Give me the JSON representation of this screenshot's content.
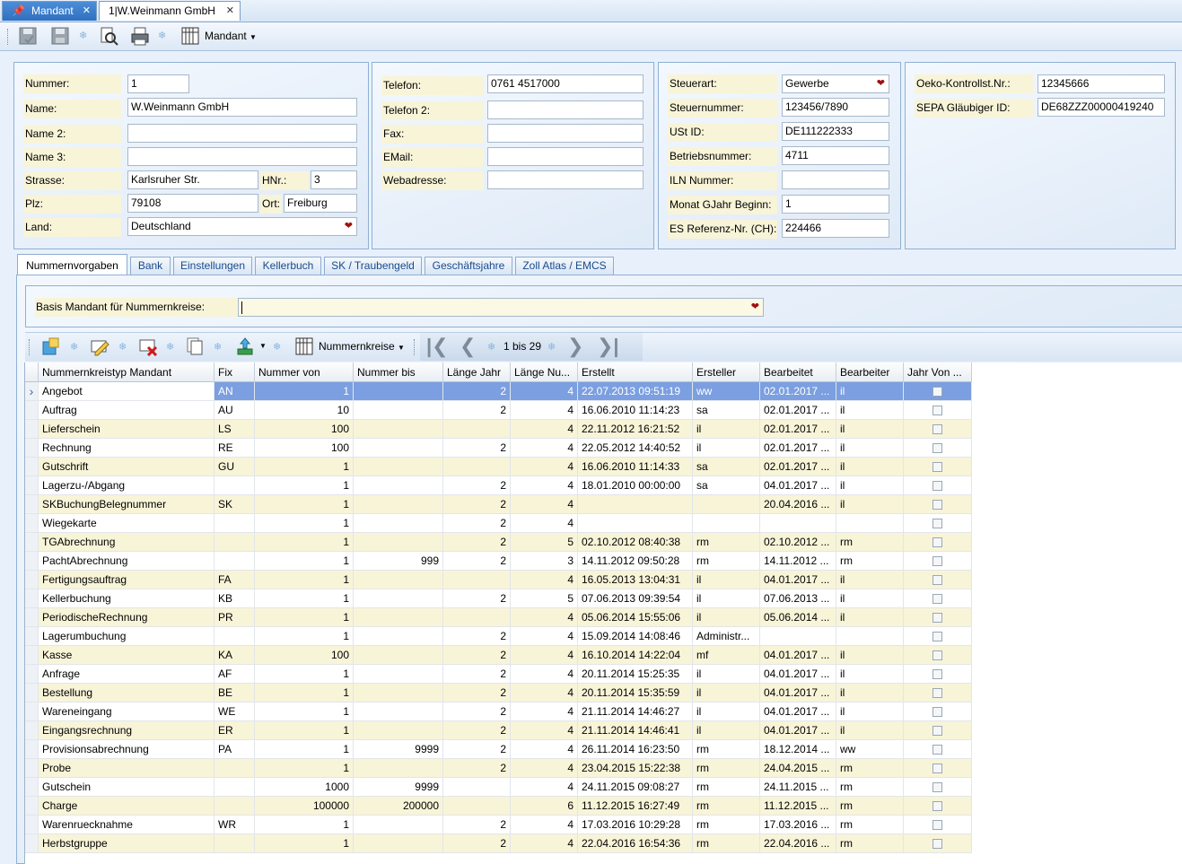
{
  "tabs": [
    {
      "label": "Mandant"
    },
    {
      "label": "1|W.Weinmann GmbH"
    }
  ],
  "toolbar": {
    "mandant_label": "Mandant"
  },
  "form": {
    "nummer_label": "Nummer:",
    "nummer": "1",
    "name_label": "Name:",
    "name": "W.Weinmann GmbH",
    "name2_label": "Name 2:",
    "name2": "",
    "name3_label": "Name 3:",
    "name3": "",
    "strasse_label": "Strasse:",
    "strasse": "Karlsruher Str.",
    "hnr_label": "HNr.:",
    "hnr": "3",
    "plz_label": "Plz:",
    "plz": "79108",
    "ort_label": "Ort:",
    "ort": "Freiburg",
    "land_label": "Land:",
    "land": "Deutschland",
    "telefon_label": "Telefon:",
    "telefon": "0761 4517000",
    "telefon2_label": "Telefon 2:",
    "telefon2": "",
    "fax_label": "Fax:",
    "fax": "",
    "email_label": "EMail:",
    "email": "",
    "web_label": "Webadresse:",
    "web": "",
    "steuerart_label": "Steuerart:",
    "steuerart": "Gewerbe",
    "steuernummer_label": "Steuernummer:",
    "steuernummer": "123456/7890",
    "ustid_label": "USt ID:",
    "ustid": "DE111222333",
    "betrieb_label": "Betriebsnummer:",
    "betrieb": "4711",
    "iln_label": "ILN Nummer:",
    "iln": "",
    "monat_label": "Monat GJahr Beginn:",
    "monat": "1",
    "esref_label": "ES Referenz-Nr. (CH):",
    "esref": "224466",
    "oeko_label": "Oeko-Kontrollst.Nr.:",
    "oeko": "12345666",
    "sepa_label": "SEPA Gläubiger ID:",
    "sepa": "DE68ZZZ00000419240"
  },
  "detail_tabs": [
    "Nummernvorgaben",
    "Bank",
    "Einstellungen",
    "Kellerbuch",
    "SK / Traubengeld",
    "Geschäftsjahre",
    "Zoll Atlas / EMCS"
  ],
  "basis": {
    "label": "Basis Mandant für Nummernkreise:",
    "value": ""
  },
  "grid_toolbar": {
    "nummernkreise_label": "Nummernkreise",
    "pager": "1 bis 29"
  },
  "columns": [
    "Nummernkreistyp  Mandant",
    "Fix",
    "Nummer von",
    "Nummer bis",
    "Länge Jahr",
    "Länge Nu...",
    "Erstellt",
    "Ersteller",
    "Bearbeitet",
    "Bearbeiter",
    "Jahr Von ..."
  ],
  "rows": [
    [
      "Angebot",
      "AN",
      "1",
      "",
      "2",
      "4",
      "22.07.2013 09:51:19",
      "ww",
      "02.01.2017 ...",
      "il"
    ],
    [
      "Auftrag",
      "AU",
      "10",
      "",
      "2",
      "4",
      "16.06.2010 11:14:23",
      "sa",
      "02.01.2017 ...",
      "il"
    ],
    [
      "Lieferschein",
      "LS",
      "100",
      "",
      "",
      "4",
      "22.11.2012 16:21:52",
      "il",
      "02.01.2017 ...",
      "il"
    ],
    [
      "Rechnung",
      "RE",
      "100",
      "",
      "2",
      "4",
      "22.05.2012 14:40:52",
      "il",
      "02.01.2017 ...",
      "il"
    ],
    [
      "Gutschrift",
      "GU",
      "1",
      "",
      "",
      "4",
      "16.06.2010 11:14:33",
      "sa",
      "02.01.2017 ...",
      "il"
    ],
    [
      "Lagerzu-/Abgang",
      "",
      "1",
      "",
      "2",
      "4",
      "18.01.2010 00:00:00",
      "sa",
      "04.01.2017 ...",
      "il"
    ],
    [
      "SKBuchungBelegnummer",
      "SK",
      "1",
      "",
      "2",
      "4",
      "",
      "",
      "20.04.2016 ...",
      "il"
    ],
    [
      "Wiegekarte",
      "",
      "1",
      "",
      "2",
      "4",
      "",
      "",
      "",
      ""
    ],
    [
      "TGAbrechnung",
      "",
      "1",
      "",
      "2",
      "5",
      "02.10.2012 08:40:38",
      "rm",
      "02.10.2012 ...",
      "rm"
    ],
    [
      "PachtAbrechnung",
      "",
      "1",
      "999",
      "2",
      "3",
      "14.11.2012 09:50:28",
      "rm",
      "14.11.2012 ...",
      "rm"
    ],
    [
      "Fertigungsauftrag",
      "FA",
      "1",
      "",
      "",
      "4",
      "16.05.2013 13:04:31",
      "il",
      "04.01.2017 ...",
      "il"
    ],
    [
      "Kellerbuchung",
      "KB",
      "1",
      "",
      "2",
      "5",
      "07.06.2013 09:39:54",
      "il",
      "07.06.2013 ...",
      "il"
    ],
    [
      "PeriodischeRechnung",
      "PR",
      "1",
      "",
      "",
      "4",
      "05.06.2014 15:55:06",
      "il",
      "05.06.2014 ...",
      "il"
    ],
    [
      "Lagerumbuchung",
      "",
      "1",
      "",
      "2",
      "4",
      "15.09.2014 14:08:46",
      "Administr...",
      "",
      ""
    ],
    [
      "Kasse",
      "KA",
      "100",
      "",
      "2",
      "4",
      "16.10.2014 14:22:04",
      "mf",
      "04.01.2017 ...",
      "il"
    ],
    [
      "Anfrage",
      "AF",
      "1",
      "",
      "2",
      "4",
      "20.11.2014 15:25:35",
      "il",
      "04.01.2017 ...",
      "il"
    ],
    [
      "Bestellung",
      "BE",
      "1",
      "",
      "2",
      "4",
      "20.11.2014 15:35:59",
      "il",
      "04.01.2017 ...",
      "il"
    ],
    [
      "Wareneingang",
      "WE",
      "1",
      "",
      "2",
      "4",
      "21.11.2014 14:46:27",
      "il",
      "04.01.2017 ...",
      "il"
    ],
    [
      "Eingangsrechnung",
      "ER",
      "1",
      "",
      "2",
      "4",
      "21.11.2014 14:46:41",
      "il",
      "04.01.2017 ...",
      "il"
    ],
    [
      "Provisionsabrechnung",
      "PA",
      "1",
      "9999",
      "2",
      "4",
      "26.11.2014 16:23:50",
      "rm",
      "18.12.2014 ...",
      "ww"
    ],
    [
      "Probe",
      "",
      "1",
      "",
      "2",
      "4",
      "23.04.2015 15:22:38",
      "rm",
      "24.04.2015 ...",
      "rm"
    ],
    [
      "Gutschein",
      "",
      "1000",
      "9999",
      "",
      "4",
      "24.11.2015 09:08:27",
      "rm",
      "24.11.2015 ...",
      "rm"
    ],
    [
      "Charge",
      "",
      "100000",
      "200000",
      "",
      "6",
      "11.12.2015 16:27:49",
      "rm",
      "11.12.2015 ...",
      "rm"
    ],
    [
      "Warenruecknahme",
      "WR",
      "1",
      "",
      "2",
      "4",
      "17.03.2016 10:29:28",
      "rm",
      "17.03.2016 ...",
      "rm"
    ],
    [
      "Herbstgruppe",
      "",
      "1",
      "",
      "2",
      "4",
      "22.04.2016 16:54:36",
      "rm",
      "22.04.2016 ...",
      "rm"
    ]
  ]
}
